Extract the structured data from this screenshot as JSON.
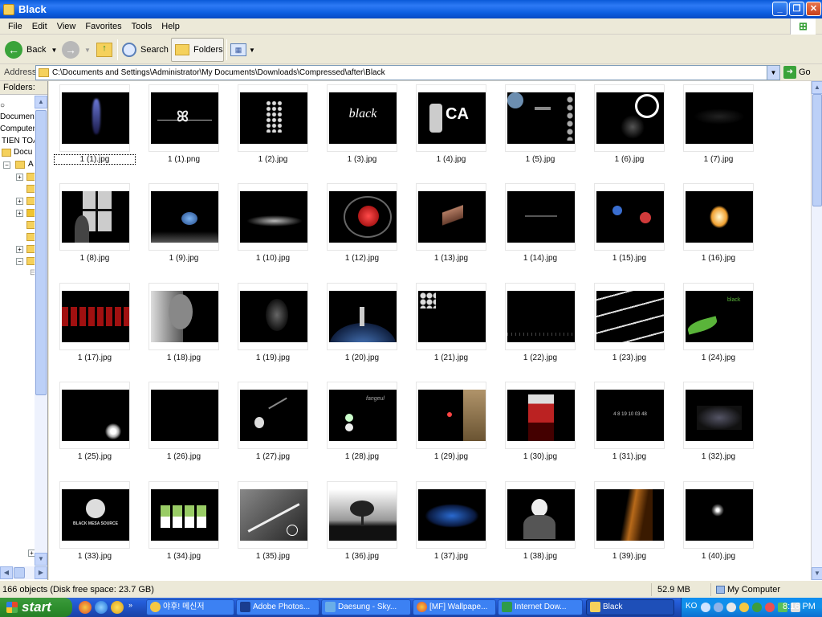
{
  "window": {
    "title": "Black"
  },
  "menu": [
    "File",
    "Edit",
    "View",
    "Favorites",
    "Tools",
    "Help"
  ],
  "toolbar": {
    "back": "Back",
    "search": "Search",
    "folders": "Folders"
  },
  "address": {
    "label": "Address",
    "value": "C:\\Documents and Settings\\Administrator\\My Documents\\Downloads\\Compressed\\after\\Black",
    "go": "Go"
  },
  "folder_pane": {
    "title": "Folders",
    "rows": [
      "Documents",
      "Computer",
      "TIEN TOA",
      "Docu",
      "A"
    ]
  },
  "files": [
    "1 (1).jpg",
    "1 (1).png",
    "1 (2).jpg",
    "1 (3).jpg",
    "1 (4).jpg",
    "1 (5).jpg",
    "1 (6).jpg",
    "1 (7).jpg",
    "1 (8).jpg",
    "1 (9).jpg",
    "1 (10).jpg",
    "1 (12).jpg",
    "1 (13).jpg",
    "1 (14).jpg",
    "1 (15).jpg",
    "1 (16).jpg",
    "1 (17).jpg",
    "1 (18).jpg",
    "1 (19).jpg",
    "1 (20).jpg",
    "1 (21).jpg",
    "1 (22).jpg",
    "1 (23).jpg",
    "1 (24).jpg",
    "1 (25).jpg",
    "1 (26).jpg",
    "1 (27).jpg",
    "1 (28).jpg",
    "1 (29).jpg",
    "1 (30).jpg",
    "1 (31).jpg",
    "1 (32).jpg",
    "1 (33).jpg",
    "1 (34).jpg",
    "1 (35).jpg",
    "1 (36).jpg",
    "1 (37).jpg",
    "1 (38).jpg",
    "1 (39).jpg",
    "1 (40).jpg"
  ],
  "thumb_text": {
    "t3": "black",
    "t4": "CA",
    "t31": "4 8 19 10 03 48",
    "t33": "BLACK MESA SOURCE",
    "t28": "fangeul",
    "t24": "black"
  },
  "status": {
    "objects": "166 objects (Disk free space: 23.7 GB)",
    "size": "52.9 MB",
    "location": "My Computer"
  },
  "taskbar": {
    "start": "start",
    "tasks": [
      "야후! 메신저",
      "Adobe Photos...",
      "Daesung - Sky...",
      "[MF] Wallpape...",
      "Internet Dow...",
      "Black"
    ],
    "lang": "KO",
    "clock": "8:16 PM"
  },
  "colors": {
    "titlebar": "#0a5ad8",
    "taskbar": "#245edb",
    "start": "#2e8f2e",
    "tray": "#1290e8"
  }
}
